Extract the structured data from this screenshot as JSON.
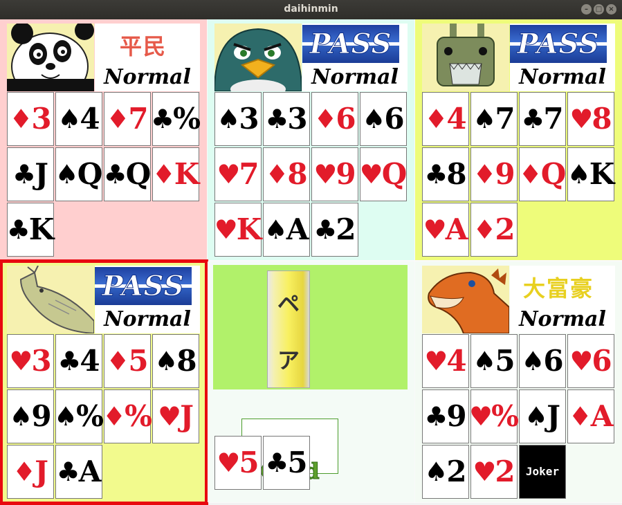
{
  "window": {
    "title": "daihinmin",
    "buttons": [
      "–",
      "□",
      "×"
    ]
  },
  "players": [
    {
      "id": "p1",
      "avatar": "panda-avatar-icon",
      "bg": "#ffcfcf",
      "status": {
        "type": "rank",
        "text": "平民",
        "color": "#e65a4a"
      },
      "mode": "Normal",
      "cards": [
        {
          "suit": "♦",
          "rank": "3",
          "color": "red"
        },
        {
          "suit": "♠",
          "rank": "4",
          "color": "black"
        },
        {
          "suit": "♦",
          "rank": "7",
          "color": "red"
        },
        {
          "suit": "♣",
          "rank": "%",
          "color": "black"
        },
        {
          "suit": "♣",
          "rank": "J",
          "color": "black"
        },
        {
          "suit": "♠",
          "rank": "Q",
          "color": "black"
        },
        {
          "suit": "♣",
          "rank": "Q",
          "color": "black"
        },
        {
          "suit": "♦",
          "rank": "K",
          "color": "red"
        },
        {
          "suit": "♣",
          "rank": "K",
          "color": "black"
        }
      ]
    },
    {
      "id": "p2",
      "avatar": "penguin-avatar-icon",
      "bg": "#defdf2",
      "status": {
        "type": "pass",
        "text": "PASS"
      },
      "mode": "Normal",
      "cards": [
        {
          "suit": "♠",
          "rank": "3",
          "color": "black"
        },
        {
          "suit": "♣",
          "rank": "3",
          "color": "black"
        },
        {
          "suit": "♦",
          "rank": "6",
          "color": "red"
        },
        {
          "suit": "♠",
          "rank": "6",
          "color": "black"
        },
        {
          "suit": "♥",
          "rank": "7",
          "color": "red"
        },
        {
          "suit": "♦",
          "rank": "8",
          "color": "red"
        },
        {
          "suit": "♥",
          "rank": "9",
          "color": "red"
        },
        {
          "suit": "♥",
          "rank": "Q",
          "color": "red"
        },
        {
          "suit": "♥",
          "rank": "K",
          "color": "red"
        },
        {
          "suit": "♠",
          "rank": "A",
          "color": "black"
        },
        {
          "suit": "♣",
          "rank": "2",
          "color": "black"
        }
      ]
    },
    {
      "id": "p3",
      "avatar": "rabbit-robot-avatar-icon",
      "bg": "#eefc7a",
      "status": {
        "type": "pass",
        "text": "PASS"
      },
      "mode": "Normal",
      "cards": [
        {
          "suit": "♦",
          "rank": "4",
          "color": "red"
        },
        {
          "suit": "♠",
          "rank": "7",
          "color": "black"
        },
        {
          "suit": "♣",
          "rank": "7",
          "color": "black"
        },
        {
          "suit": "♥",
          "rank": "8",
          "color": "red"
        },
        {
          "suit": "♣",
          "rank": "8",
          "color": "black"
        },
        {
          "suit": "♦",
          "rank": "9",
          "color": "red"
        },
        {
          "suit": "♦",
          "rank": "Q",
          "color": "red"
        },
        {
          "suit": "♠",
          "rank": "K",
          "color": "black"
        },
        {
          "suit": "♥",
          "rank": "A",
          "color": "red"
        },
        {
          "suit": "♦",
          "rank": "2",
          "color": "red"
        }
      ]
    },
    {
      "id": "p4",
      "avatar": "fish-avatar-icon",
      "bg": "#f2fa8d",
      "status": {
        "type": "pass",
        "text": "PASS"
      },
      "mode": "Normal",
      "selected": true,
      "cards": [
        {
          "suit": "♥",
          "rank": "3",
          "color": "red"
        },
        {
          "suit": "♣",
          "rank": "4",
          "color": "black"
        },
        {
          "suit": "♦",
          "rank": "5",
          "color": "red"
        },
        {
          "suit": "♠",
          "rank": "8",
          "color": "black"
        },
        {
          "suit": "♠",
          "rank": "9",
          "color": "black"
        },
        {
          "suit": "♠",
          "rank": "%",
          "color": "black"
        },
        {
          "suit": "♦",
          "rank": "%",
          "color": "red"
        },
        {
          "suit": "♥",
          "rank": "J",
          "color": "red"
        },
        {
          "suit": "♦",
          "rank": "J",
          "color": "red"
        },
        {
          "suit": "♣",
          "rank": "A",
          "color": "black"
        }
      ]
    },
    {
      "id": "p5",
      "avatar": "dinosaur-avatar-icon",
      "bg": "#f4fbf4",
      "status": {
        "type": "rank",
        "text": "大富豪",
        "color": "#e8d020"
      },
      "mode": "Normal",
      "cards": [
        {
          "suit": "♥",
          "rank": "4",
          "color": "red"
        },
        {
          "suit": "♠",
          "rank": "5",
          "color": "black"
        },
        {
          "suit": "♠",
          "rank": "6",
          "color": "black"
        },
        {
          "suit": "♥",
          "rank": "6",
          "color": "red"
        },
        {
          "suit": "♣",
          "rank": "9",
          "color": "black"
        },
        {
          "suit": "♥",
          "rank": "%",
          "color": "red"
        },
        {
          "suit": "♠",
          "rank": "J",
          "color": "black"
        },
        {
          "suit": "♦",
          "rank": "A",
          "color": "red"
        },
        {
          "suit": "♠",
          "rank": "2",
          "color": "black"
        },
        {
          "suit": "♥",
          "rank": "2",
          "color": "red"
        },
        {
          "suit": "",
          "rank": "Joker",
          "color": "joker"
        }
      ]
    }
  ],
  "field": {
    "pair_label": [
      "ペ",
      "ア"
    ],
    "no_card_text": "NO Card",
    "played_cards": [
      {
        "suit": "♥",
        "rank": "5",
        "color": "red"
      },
      {
        "suit": "♣",
        "rank": "5",
        "color": "black"
      }
    ]
  }
}
